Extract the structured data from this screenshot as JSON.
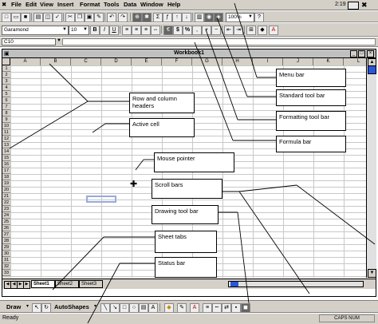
{
  "menu": {
    "items": [
      "File",
      "Edit",
      "View",
      "Insert",
      "Format",
      "Tools",
      "Data",
      "Window",
      "Help"
    ],
    "clock": "2:19 pm"
  },
  "standard_toolbar": {
    "zoom": "100%"
  },
  "formatting_toolbar": {
    "font": "Garamond",
    "font_size": "10",
    "bold": "B",
    "italic": "I",
    "underline": "U",
    "currency": "$",
    "percent": "%"
  },
  "formula_bar": {
    "name_box": "C10"
  },
  "workbook": {
    "title": "Workbook1",
    "columns": [
      "A",
      "B",
      "C",
      "D",
      "E",
      "F",
      "G",
      "H",
      "I",
      "J",
      "K",
      "L"
    ],
    "rows": [
      "1",
      "2",
      "3",
      "4",
      "5",
      "6",
      "7",
      "8",
      "9",
      "10",
      "11",
      "12",
      "13",
      "14",
      "15",
      "16",
      "17",
      "18",
      "19",
      "20",
      "21",
      "22",
      "23",
      "24",
      "25",
      "26",
      "27",
      "28",
      "29",
      "30",
      "31",
      "32",
      "33"
    ],
    "sheet_tabs": [
      "Sheet1",
      "Sheet2",
      "Sheet3"
    ]
  },
  "drawing_toolbar": {
    "draw_label": "Draw",
    "autoshapes_label": "AutoShapes"
  },
  "status_bar": {
    "text": "Ready",
    "caps": "CAPS",
    "num": "NUM"
  },
  "callouts": {
    "menu_bar": "Menu bar",
    "standard_toolbar": "Standard tool bar",
    "formatting_toolbar": "Formatting tool bar",
    "formula_bar": "Formula bar",
    "row_col_headers": "Row and column headers",
    "active_cell": "Active cell",
    "mouse_pointer": "Mouse pointer",
    "scroll_bars": "Scroll bars",
    "drawing_toolbar": "Drawing tool bar",
    "sheet_tabs": "Sheet tabs",
    "status_bar": "Status bar"
  }
}
